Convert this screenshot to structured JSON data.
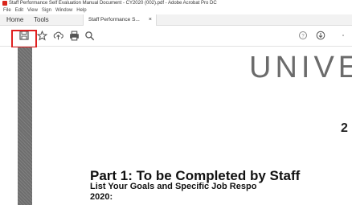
{
  "window": {
    "title": "Staff Performance Self Evaluation Manual Document - CY2020 (002).pdf - Adobe Acrobat Pro DC"
  },
  "menu": {
    "items": [
      "File",
      "Edit",
      "View",
      "Sign",
      "Window",
      "Help"
    ]
  },
  "tabs": {
    "home": "Home",
    "tools": "Tools",
    "document": "Staff Performance S...",
    "close": "×"
  },
  "toolbar": {
    "icons": [
      "save-icon",
      "bookmark-star-icon",
      "upload-icon",
      "print-icon",
      "search-icon",
      "help-icon",
      "download-icon"
    ],
    "highlight_color": "#e02020"
  },
  "document": {
    "header_fragment": "UNIVE",
    "number_fragment": "2",
    "part_heading": "Part 1:  To be Completed by Staff",
    "goals_line": "List Your Goals and Specific Job Respo",
    "year_line": "2020:"
  }
}
